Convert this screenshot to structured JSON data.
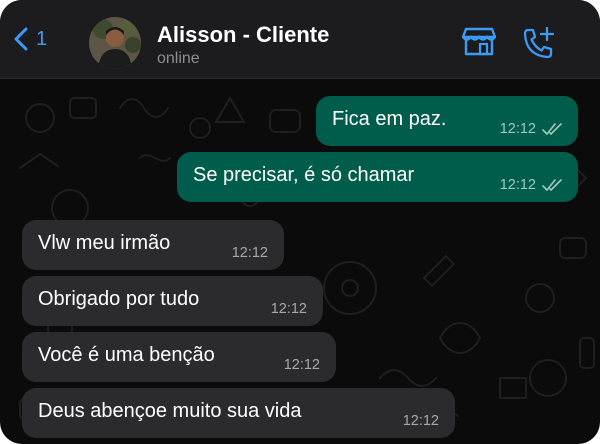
{
  "header": {
    "back_count": "1",
    "contact_name": "Alisson - Cliente",
    "contact_status": "online",
    "icons": [
      "chevron-left-icon",
      "storefront-icon",
      "phone-add-icon"
    ]
  },
  "messages": [
    {
      "direction": "out",
      "text": "Fica em paz.",
      "time": "12:12",
      "status": "read"
    },
    {
      "direction": "out",
      "text": "Se precisar, é só chamar",
      "time": "12:12",
      "status": "read"
    },
    {
      "direction": "in",
      "text": "Vlw meu irmão",
      "time": "12:12"
    },
    {
      "direction": "in",
      "text": "Obrigado por tudo",
      "time": "12:12"
    },
    {
      "direction": "in",
      "text": "Você é uma benção",
      "time": "12:12"
    },
    {
      "direction": "in",
      "text": "Deus abençoe muito sua vida",
      "time": "12:12"
    }
  ],
  "colors": {
    "accent": "#3b9bf6",
    "outgoing_bubble": "#005c4b",
    "incoming_bubble": "#2b2b2d",
    "background": "#0b0b0b"
  }
}
